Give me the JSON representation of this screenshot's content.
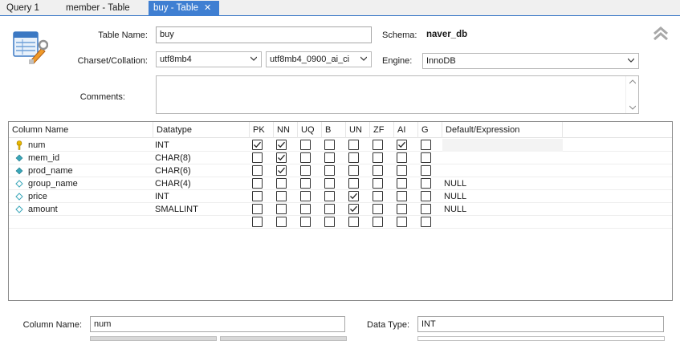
{
  "tabs": [
    {
      "label": "Query 1",
      "active": false
    },
    {
      "label": "member - Table",
      "active": false
    },
    {
      "label": "buy - Table",
      "active": true,
      "closable": true
    }
  ],
  "form": {
    "table_name_label": "Table Name:",
    "table_name_value": "buy",
    "schema_label": "Schema:",
    "schema_value": "naver_db",
    "charset_label": "Charset/Collation:",
    "charset_value": "utf8mb4",
    "collation_value": "utf8mb4_0900_ai_ci",
    "engine_label": "Engine:",
    "engine_value": "InnoDB",
    "comments_label": "Comments:",
    "comments_value": ""
  },
  "grid": {
    "headers": [
      "Column Name",
      "Datatype",
      "PK",
      "NN",
      "UQ",
      "B",
      "UN",
      "ZF",
      "AI",
      "G",
      "Default/Expression"
    ],
    "rows": [
      {
        "name": "num",
        "type": "INT",
        "icon": "primary-key",
        "flags": [
          true,
          true,
          false,
          false,
          false,
          false,
          true,
          false
        ],
        "default": ""
      },
      {
        "name": "mem_id",
        "type": "CHAR(8)",
        "icon": "column",
        "flags": [
          false,
          true,
          false,
          false,
          false,
          false,
          false,
          false
        ],
        "default": ""
      },
      {
        "name": "prod_name",
        "type": "CHAR(6)",
        "icon": "column",
        "flags": [
          false,
          true,
          false,
          false,
          false,
          false,
          false,
          false
        ],
        "default": ""
      },
      {
        "name": "group_name",
        "type": "CHAR(4)",
        "icon": "nullable-column",
        "flags": [
          false,
          false,
          false,
          false,
          false,
          false,
          false,
          false
        ],
        "default": "NULL"
      },
      {
        "name": "price",
        "type": "INT",
        "icon": "nullable-column",
        "flags": [
          false,
          false,
          false,
          false,
          true,
          false,
          false,
          false
        ],
        "default": "NULL"
      },
      {
        "name": "amount",
        "type": "SMALLINT",
        "icon": "nullable-column",
        "flags": [
          false,
          false,
          false,
          false,
          true,
          false,
          false,
          false
        ],
        "default": "NULL"
      },
      {
        "name": "",
        "type": "",
        "icon": "",
        "flags": [
          false,
          false,
          false,
          false,
          false,
          false,
          false,
          false
        ],
        "default": ""
      }
    ]
  },
  "detail": {
    "column_name_label": "Column Name:",
    "column_name_value": "num",
    "data_type_label": "Data Type:",
    "data_type_value": "INT"
  },
  "colors": {
    "active_tab": "#3f7fd2",
    "key_icon": "#e8b800",
    "column_icon": "#3aa6b9"
  }
}
